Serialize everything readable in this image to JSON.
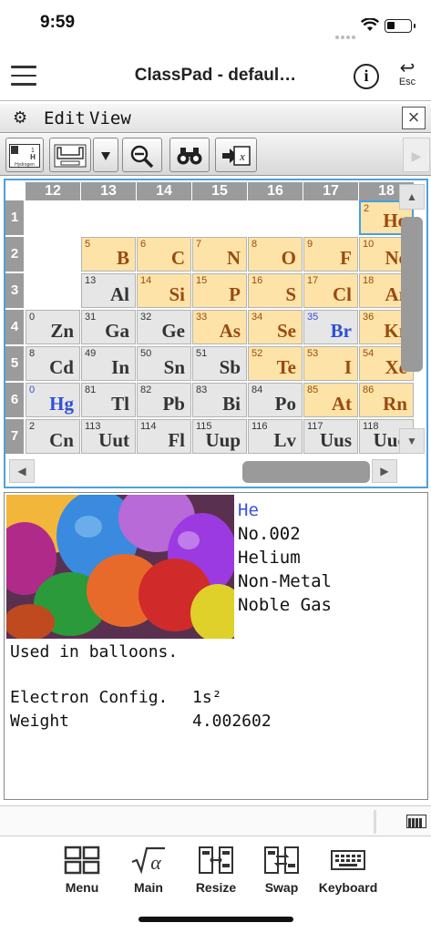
{
  "status": {
    "time": "9:59"
  },
  "app": {
    "title": "ClassPad - defaul…",
    "info_label": "i",
    "esc_label": "Esc"
  },
  "menubar": {
    "edit": "Edit",
    "view": "View",
    "close": "×"
  },
  "toolbar": {
    "buttons": [
      {
        "icon": "element-hydrogen-icon",
        "label": "Hydrogen",
        "num": "1",
        "sym": "H"
      },
      {
        "icon": "table-layout-icon"
      },
      {
        "icon": "dropdown-arrow-icon"
      },
      {
        "icon": "zoom-out-icon"
      },
      {
        "icon": "binoculars-icon"
      },
      {
        "icon": "paste-variable-icon"
      }
    ],
    "next": "▶"
  },
  "ptable": {
    "columns": [
      "12",
      "13",
      "14",
      "15",
      "16",
      "17",
      "18"
    ],
    "rows": [
      "1",
      "2",
      "3",
      "4",
      "5",
      "6",
      "7"
    ],
    "cells": [
      {
        "row": 1,
        "col": 6,
        "num": "2",
        "sym": "He",
        "color": "orange",
        "selected": true
      },
      {
        "row": 2,
        "col": 1,
        "num": "5",
        "sym": "B",
        "color": "orange"
      },
      {
        "row": 2,
        "col": 2,
        "num": "6",
        "sym": "C",
        "color": "orange"
      },
      {
        "row": 2,
        "col": 3,
        "num": "7",
        "sym": "N",
        "color": "orange"
      },
      {
        "row": 2,
        "col": 4,
        "num": "8",
        "sym": "O",
        "color": "orange"
      },
      {
        "row": 2,
        "col": 5,
        "num": "9",
        "sym": "F",
        "color": "orange"
      },
      {
        "row": 2,
        "col": 6,
        "num": "10",
        "sym": "Ne",
        "color": "orange"
      },
      {
        "row": 3,
        "col": 1,
        "num": "13",
        "sym": "Al",
        "color": "gray"
      },
      {
        "row": 3,
        "col": 2,
        "num": "14",
        "sym": "Si",
        "color": "orange"
      },
      {
        "row": 3,
        "col": 3,
        "num": "15",
        "sym": "P",
        "color": "orange"
      },
      {
        "row": 3,
        "col": 4,
        "num": "16",
        "sym": "S",
        "color": "orange"
      },
      {
        "row": 3,
        "col": 5,
        "num": "17",
        "sym": "Cl",
        "color": "orange"
      },
      {
        "row": 3,
        "col": 6,
        "num": "18",
        "sym": "Ar",
        "color": "orange"
      },
      {
        "row": 4,
        "col": 0,
        "num": "0",
        "sym": "Zn",
        "color": "gray"
      },
      {
        "row": 4,
        "col": 1,
        "num": "31",
        "sym": "Ga",
        "color": "gray"
      },
      {
        "row": 4,
        "col": 2,
        "num": "32",
        "sym": "Ge",
        "color": "gray"
      },
      {
        "row": 4,
        "col": 3,
        "num": "33",
        "sym": "As",
        "color": "orange"
      },
      {
        "row": 4,
        "col": 4,
        "num": "34",
        "sym": "Se",
        "color": "orange"
      },
      {
        "row": 4,
        "col": 5,
        "num": "35",
        "sym": "Br",
        "color": "blue"
      },
      {
        "row": 4,
        "col": 6,
        "num": "36",
        "sym": "Kr",
        "color": "orange"
      },
      {
        "row": 5,
        "col": 0,
        "num": "8",
        "sym": "Cd",
        "color": "gray"
      },
      {
        "row": 5,
        "col": 1,
        "num": "49",
        "sym": "In",
        "color": "gray"
      },
      {
        "row": 5,
        "col": 2,
        "num": "50",
        "sym": "Sn",
        "color": "gray"
      },
      {
        "row": 5,
        "col": 3,
        "num": "51",
        "sym": "Sb",
        "color": "gray"
      },
      {
        "row": 5,
        "col": 4,
        "num": "52",
        "sym": "Te",
        "color": "orange"
      },
      {
        "row": 5,
        "col": 5,
        "num": "53",
        "sym": "I",
        "color": "orange"
      },
      {
        "row": 5,
        "col": 6,
        "num": "54",
        "sym": "Xe",
        "color": "orange"
      },
      {
        "row": 6,
        "col": 0,
        "num": "0",
        "sym": "Hg",
        "color": "blue"
      },
      {
        "row": 6,
        "col": 1,
        "num": "81",
        "sym": "Tl",
        "color": "gray"
      },
      {
        "row": 6,
        "col": 2,
        "num": "82",
        "sym": "Pb",
        "color": "gray"
      },
      {
        "row": 6,
        "col": 3,
        "num": "83",
        "sym": "Bi",
        "color": "gray"
      },
      {
        "row": 6,
        "col": 4,
        "num": "84",
        "sym": "Po",
        "color": "gray"
      },
      {
        "row": 6,
        "col": 5,
        "num": "85",
        "sym": "At",
        "color": "orange"
      },
      {
        "row": 6,
        "col": 6,
        "num": "86",
        "sym": "Rn",
        "color": "orange"
      },
      {
        "row": 7,
        "col": 0,
        "num": "2",
        "sym": "Cn",
        "color": "gray"
      },
      {
        "row": 7,
        "col": 1,
        "num": "113",
        "sym": "Uut",
        "color": "gray"
      },
      {
        "row": 7,
        "col": 2,
        "num": "114",
        "sym": "Fl",
        "color": "gray"
      },
      {
        "row": 7,
        "col": 3,
        "num": "115",
        "sym": "Uup",
        "color": "gray"
      },
      {
        "row": 7,
        "col": 4,
        "num": "116",
        "sym": "Lv",
        "color": "gray"
      },
      {
        "row": 7,
        "col": 5,
        "num": "117",
        "sym": "Uus",
        "color": "gray"
      },
      {
        "row": 7,
        "col": 6,
        "num": "118",
        "sym": "Uuo",
        "color": "gray"
      }
    ],
    "scroll": {
      "up": "▲",
      "down": "▼",
      "left": "◀",
      "right": "▶"
    }
  },
  "detail": {
    "symbol": "He",
    "number": "No.002",
    "name": "Helium",
    "category": "Non-Metal",
    "group": "Noble Gas",
    "usage": "Used in balloons.",
    "config_label": "Electron Config.",
    "config_value": "1s²",
    "weight_label": "Weight",
    "weight_value": "4.002602"
  },
  "nav": {
    "items": [
      {
        "label": "Menu",
        "icon": "menu-grid-icon"
      },
      {
        "label": "Main",
        "icon": "sqrt-alpha-icon"
      },
      {
        "label": "Resize",
        "icon": "resize-icon"
      },
      {
        "label": "Swap",
        "icon": "swap-icon"
      },
      {
        "label": "Keyboard",
        "icon": "keyboard-icon"
      }
    ]
  },
  "colors": {
    "accent_blue": "#4ea0e0",
    "nonmetal_orange": "#fde3a7",
    "metal_gray": "#e6e6e6",
    "liquid_blue": "#2f4fd8"
  }
}
